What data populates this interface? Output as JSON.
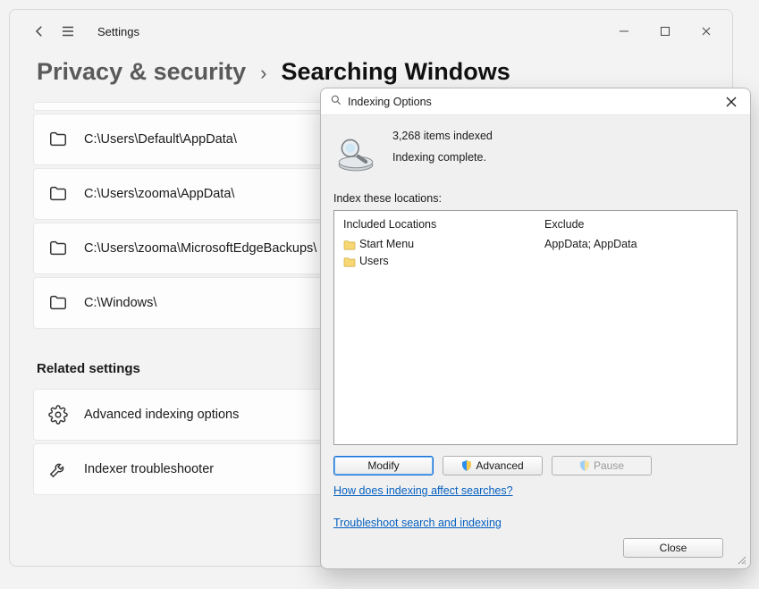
{
  "settings": {
    "app_title": "Settings",
    "breadcrumb": {
      "parent": "Privacy & security",
      "separator": "›",
      "current": "Searching Windows"
    },
    "folder_items": [
      "C:\\Users\\Default\\AppData\\",
      "C:\\Users\\zooma\\AppData\\",
      "C:\\Users\\zooma\\MicrosoftEdgeBackups\\",
      "C:\\Windows\\"
    ],
    "related_heading": "Related settings",
    "related_items": [
      "Advanced indexing options",
      "Indexer troubleshooter"
    ]
  },
  "dialog": {
    "title": "Indexing Options",
    "status_count": "3,268 items indexed",
    "status_state": "Indexing complete.",
    "index_label": "Index these locations:",
    "columns": {
      "included_header": "Included Locations",
      "exclude_header": "Exclude"
    },
    "included": [
      "Start Menu",
      "Users"
    ],
    "excluded": [
      "",
      "AppData; AppData"
    ],
    "buttons": {
      "modify": "Modify",
      "advanced": "Advanced",
      "pause": "Pause",
      "close": "Close"
    },
    "links": {
      "how": "How does indexing affect searches?",
      "troubleshoot": "Troubleshoot search and indexing"
    }
  }
}
